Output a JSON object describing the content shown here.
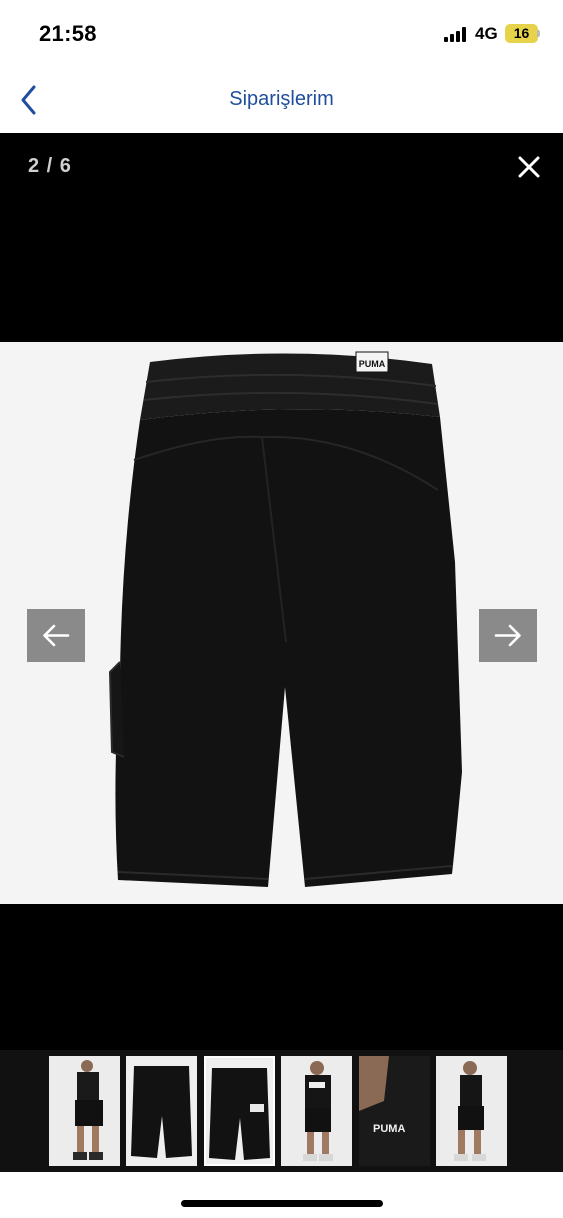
{
  "status": {
    "time": "21:58",
    "network": "4G",
    "battery": "16"
  },
  "nav": {
    "title": "Siparişlerim",
    "back_icon": "chevron-left-icon"
  },
  "viewer": {
    "counter": "2 / 6",
    "current_index": 2,
    "total": 6,
    "close_icon": "close-icon",
    "prev_icon": "arrow-left-icon",
    "next_icon": "arrow-right-icon",
    "image_label": "PUMA",
    "thumbnail_brand": "PUMA"
  },
  "colors": {
    "accent": "#1f4e9c",
    "viewer_bg": "#000000",
    "arrow_button": "#8a8a8a",
    "battery": "#e6d34a"
  }
}
